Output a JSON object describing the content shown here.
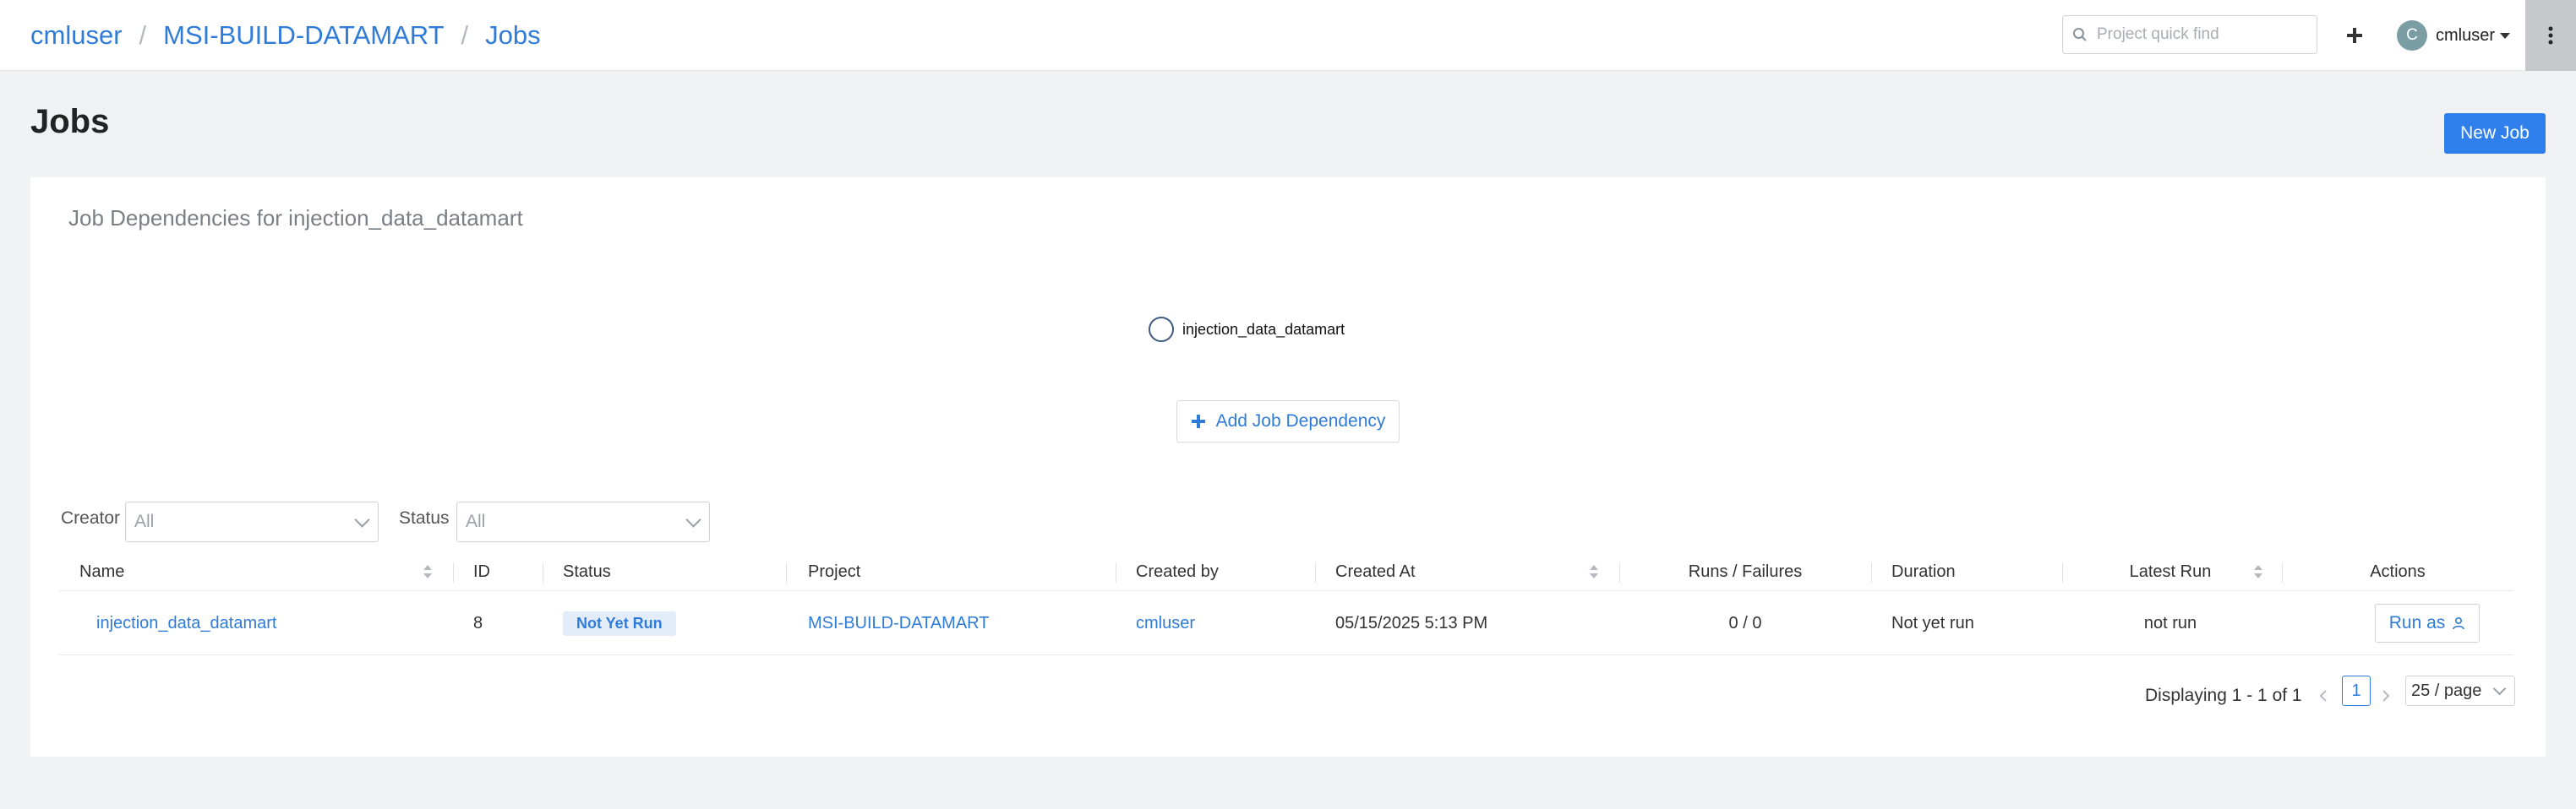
{
  "breadcrumb": {
    "items": [
      "cmluser",
      "MSI-BUILD-DATAMART",
      "Jobs"
    ],
    "separator": "/"
  },
  "header": {
    "search_placeholder": "Project quick find",
    "add_icon": "plus-icon",
    "user_initial": "C",
    "user_name": "cmluser",
    "menu_icon": "kebab-menu-icon"
  },
  "page": {
    "title": "Jobs",
    "new_job_label": "New Job"
  },
  "dependencies": {
    "title": "Job Dependencies for injection_data_datamart",
    "node_label": "injection_data_datamart",
    "add_button_label": "Add Job Dependency"
  },
  "filters": {
    "creator_label": "Creator",
    "creator_value": "All",
    "status_label": "Status",
    "status_value": "All"
  },
  "table": {
    "columns": [
      "Name",
      "ID",
      "Status",
      "Project",
      "Created by",
      "Created At",
      "Runs / Failures",
      "Duration",
      "Latest Run",
      "Actions"
    ],
    "rows": [
      {
        "name": "injection_data_datamart",
        "id": "8",
        "status": "Not Yet Run",
        "project": "MSI-BUILD-DATAMART",
        "created_by": "cmluser",
        "created_at": "05/15/2025 5:13 PM",
        "runs_failures": "0 / 0",
        "duration": "Not yet run",
        "latest_run": "not run",
        "action_label": "Run as"
      }
    ]
  },
  "pagination": {
    "summary": "Displaying 1 - 1 of 1",
    "current_page": "1",
    "page_size": "25 / page"
  },
  "colors": {
    "accent": "#2f80ed",
    "link": "#2f7bd8",
    "badge_bg": "#e3edfa"
  }
}
